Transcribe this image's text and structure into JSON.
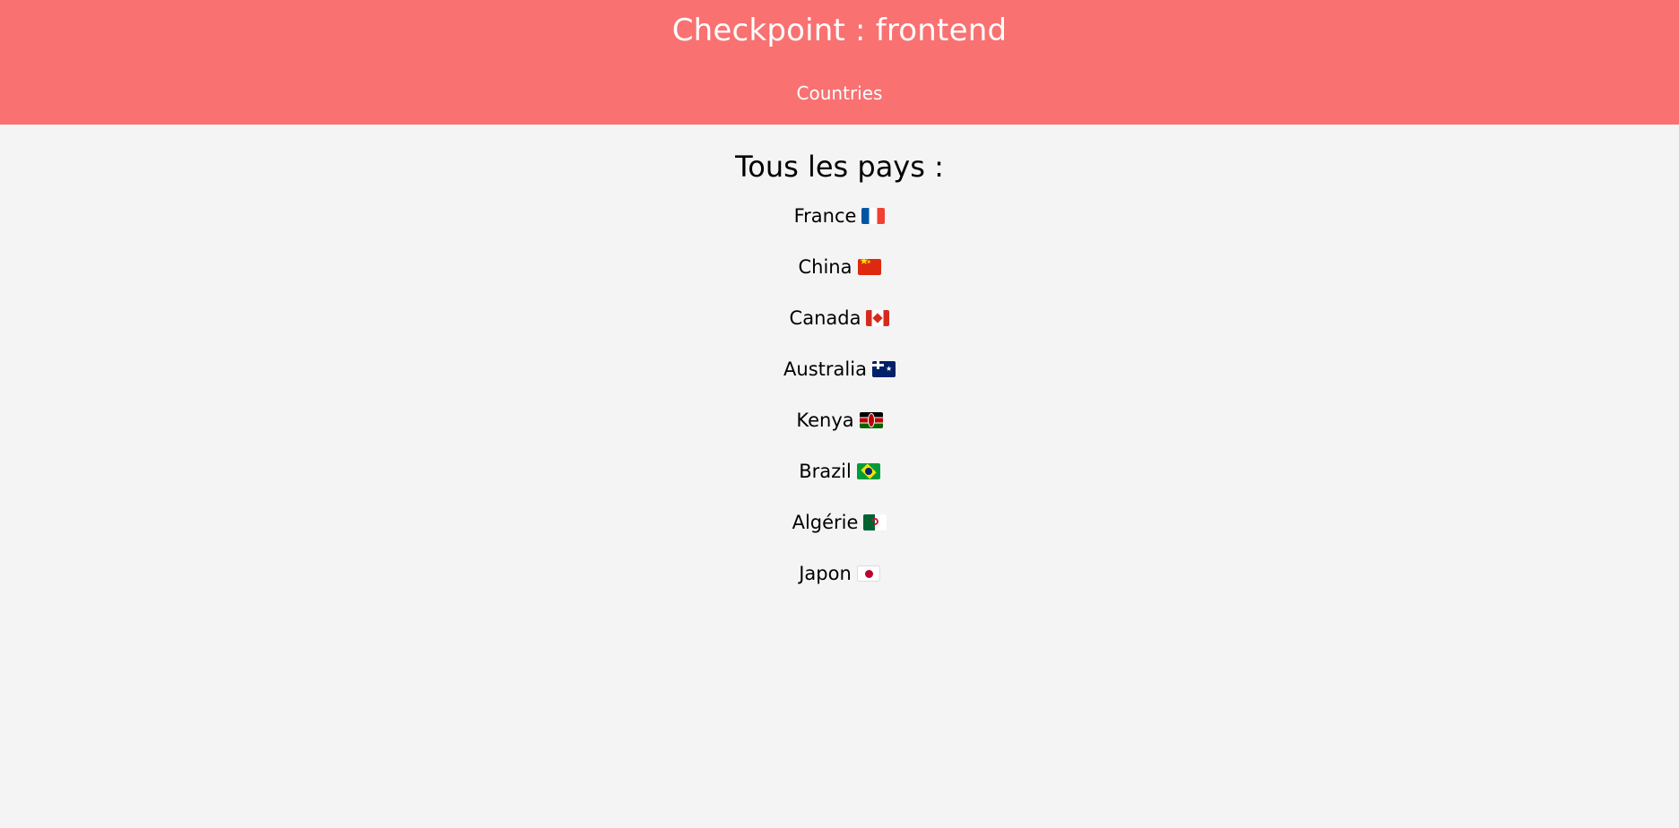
{
  "header": {
    "title": "Checkpoint : frontend",
    "nav": {
      "countries_link": "Countries"
    }
  },
  "main": {
    "heading": "Tous les pays :",
    "countries": [
      {
        "name": "France",
        "flag_icon": "france-flag-icon"
      },
      {
        "name": "China",
        "flag_icon": "china-flag-icon"
      },
      {
        "name": "Canada",
        "flag_icon": "canada-flag-icon"
      },
      {
        "name": "Australia",
        "flag_icon": "australia-flag-icon"
      },
      {
        "name": "Kenya",
        "flag_icon": "kenya-flag-icon"
      },
      {
        "name": "Brazil",
        "flag_icon": "brazil-flag-icon"
      },
      {
        "name": "Algérie",
        "flag_icon": "algeria-flag-icon"
      },
      {
        "name": "Japon",
        "flag_icon": "japan-flag-icon"
      }
    ]
  },
  "colors": {
    "header_background": "#f97171",
    "page_background": "#f4f4f4",
    "header_text": "#ffffff",
    "body_text": "#000000"
  }
}
